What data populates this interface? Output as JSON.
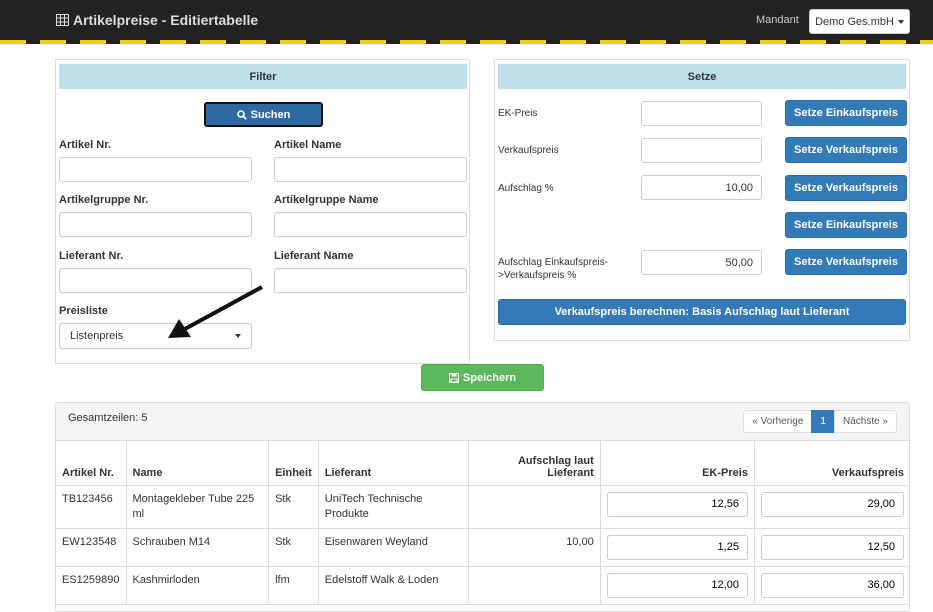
{
  "header": {
    "title": "Artikelpreise - Editiertabelle",
    "mandant_label": "Mandant",
    "mandant_value": "Demo Ges.mbH"
  },
  "filter": {
    "heading": "Filter",
    "search_button": "Suchen",
    "fields": {
      "artikel_nr": "Artikel Nr.",
      "artikel_name": "Artikel Name",
      "artikelgruppe_nr": "Artikelgruppe Nr.",
      "artikelgruppe_name": "Artikelgruppe Name",
      "lieferant_nr": "Lieferant Nr.",
      "lieferant_name": "Lieferant Name",
      "preisliste": "Preisliste"
    },
    "preisliste_value": "Listenpreis"
  },
  "setze": {
    "heading": "Setze",
    "ek_preis_label": "EK-Preis",
    "verkaufspreis_label": "Verkaufspreis",
    "aufschlag_label": "Aufschlag %",
    "aufschlag_value": "10,00",
    "aufschlag_ek_vk_label_1": "Aufschlag Einkaufspreis-",
    "aufschlag_ek_vk_label_2": ">Verkaufspreis %",
    "aufschlag_ek_vk_value": "50,00",
    "btn_setze_einkaufspreis": "Setze Einkaufspreis",
    "btn_setze_verkaufspreis": "Setze Verkaufspreis",
    "btn_berechnen": "Verkaufspreis berechnen: Basis Aufschlag laut Lieferant"
  },
  "save_button": "Speichern",
  "table": {
    "total_rows": "Gesamtzeilen: 5",
    "pager": {
      "prev": "« Vorherige",
      "page": "1",
      "next": "Nächste »"
    },
    "headers": {
      "artikel_nr": "Artikel Nr.",
      "name": "Name",
      "einheit": "Einheit",
      "lieferant": "Lieferant",
      "aufschlag_1": "Aufschlag laut",
      "aufschlag_2": "Lieferant",
      "ek_preis": "EK-Preis",
      "verkaufspreis": "Verkaufspreis"
    },
    "rows": [
      {
        "artikel_nr": "TB123456",
        "name": "Montagekleber Tube 225 ml",
        "einheit": "Stk",
        "lieferant": "UniTech Technische Produkte",
        "aufschlag": "",
        "ek": "12,56",
        "vk": "29,00"
      },
      {
        "artikel_nr": "EW123548",
        "name": "Schrauben M14",
        "einheit": "Stk",
        "lieferant": "Eisenwaren Weyland",
        "aufschlag": "10,00",
        "ek": "1,25",
        "vk": "12,50"
      },
      {
        "artikel_nr": "ES1259890",
        "name": "Kashmirloden",
        "einheit": "lfm",
        "lieferant": "Edelstoff Walk & Loden",
        "aufschlag": "",
        "ek": "12,00",
        "vk": "36,00"
      }
    ]
  },
  "colors": {
    "topbar": "#222222",
    "stripe": "#f0d000",
    "panel_head": "#bee0ea",
    "primary": "#337ab7",
    "success": "#5cb85c"
  }
}
